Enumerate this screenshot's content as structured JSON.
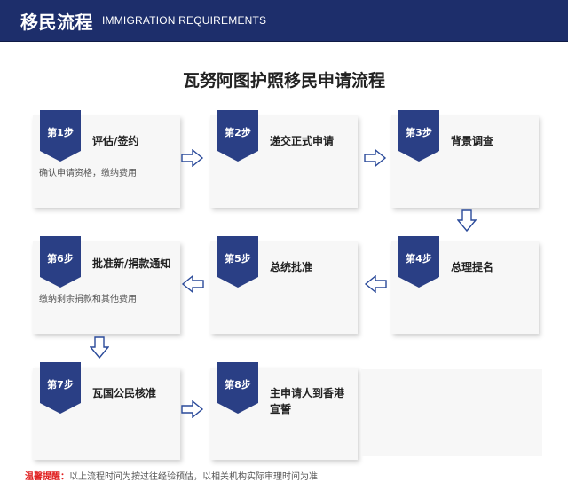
{
  "header": {
    "title": "移民流程",
    "subtitle": "IMMIGRATION REQUIREMENTS"
  },
  "main_title": "瓦努阿图护照移民申请流程",
  "steps": [
    {
      "badge": "第1步",
      "title": "评估/签约",
      "desc": "确认申请资格，缴纳费用"
    },
    {
      "badge": "第2步",
      "title": "递交正式申请",
      "desc": ""
    },
    {
      "badge": "第3步",
      "title": "背景调查",
      "desc": ""
    },
    {
      "badge": "第4步",
      "title": "总理提名",
      "desc": ""
    },
    {
      "badge": "第5步",
      "title": "总统批准",
      "desc": ""
    },
    {
      "badge": "第6步",
      "title": "批准新/捐款通知",
      "desc": "缴纳剩余捐款和其他费用"
    },
    {
      "badge": "第7步",
      "title": "瓦国公民核准",
      "desc": ""
    },
    {
      "badge": "第8步",
      "title": "主申请人到香港宣誓",
      "desc": ""
    }
  ],
  "footer": {
    "warning_label": "温馨提醒：",
    "note": "以上流程时间为按过往经验预估，以相关机构实际审理时间为准"
  },
  "colors": {
    "header_bg": "#1d2e6b",
    "badge": "#2a3f85",
    "arrow": "#2a4a9a",
    "warning": "#e02020"
  }
}
